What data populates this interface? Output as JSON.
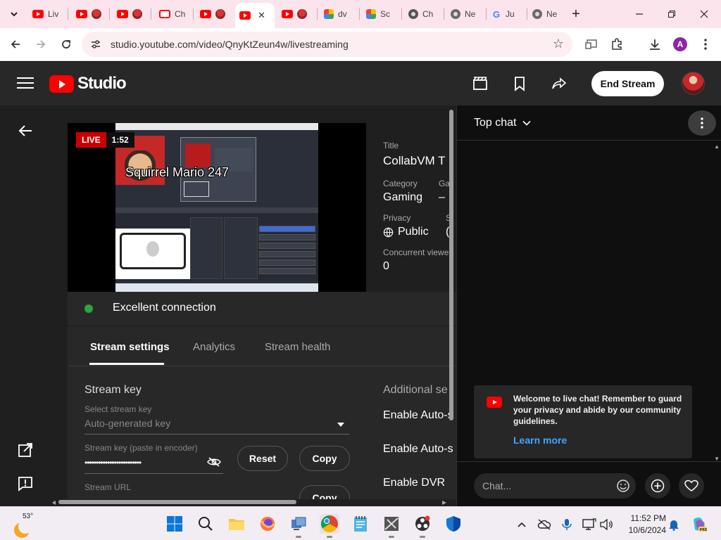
{
  "browser": {
    "tabs": [
      {
        "label": "Liv",
        "icon": "youtube-icon"
      },
      {
        "label": "",
        "icon": "mario-icon"
      },
      {
        "label": "",
        "icon": "mario-icon"
      },
      {
        "label": "Ch",
        "icon": "youtube-icon"
      },
      {
        "label": "",
        "icon": "mario-icon"
      },
      {
        "label": "",
        "icon": "youtube-icon",
        "active": true
      },
      {
        "label": "",
        "icon": "mario-icon"
      },
      {
        "label": "dv",
        "icon": "photos-icon"
      },
      {
        "label": "Sc",
        "icon": "photos-icon"
      },
      {
        "label": "Ch",
        "icon": "openai-icon"
      },
      {
        "label": "Ne",
        "icon": "chrome-icon"
      },
      {
        "label": "Ju",
        "icon": "google-icon"
      },
      {
        "label": "Ne",
        "icon": "chrome-icon"
      }
    ],
    "url": "studio.youtube.com/video/QnyKtZeun4w/livestreaming",
    "profile_initial": "A",
    "new_tab": "+",
    "close_tab": "✕"
  },
  "studio": {
    "logo_text": "Studio",
    "end_stream_label": "End Stream"
  },
  "preview": {
    "live_label": "LIVE",
    "elapsed": "1:52",
    "overlay_title": "Squirrel Mario 247"
  },
  "info": {
    "title_label": "Title",
    "title_value": "CollabVM T",
    "category_label": "Category",
    "category_value": "Gaming",
    "ga_label": "Ga",
    "ga_value": "–",
    "privacy_label": "Privacy",
    "privacy_value": "Public",
    "s_label": "S",
    "s_value": "(",
    "viewers_label": "Concurrent viewe",
    "viewers_value": "0"
  },
  "connection": {
    "status": "Excellent connection",
    "color": "#2ba640"
  },
  "tabs": {
    "stream_settings": "Stream settings",
    "analytics": "Analytics",
    "stream_health": "Stream health"
  },
  "settings": {
    "stream_key_title": "Stream key",
    "select_key_label": "Select stream key",
    "select_key_value": "Auto-generated key",
    "paste_label": "Stream key (paste in encoder)",
    "key_masked": "•••••••••••••••••••••••••",
    "reset_label": "Reset",
    "copy_label": "Copy",
    "url_label": "Stream URL",
    "copy2_label": "Copy",
    "additional_title": "Additional se",
    "opt1": "Enable Auto-s",
    "opt2": "Enable Auto-s",
    "opt3": "Enable DVR"
  },
  "chat": {
    "mode": "Top chat",
    "welcome": "Welcome to live chat! Remember to guard your privacy and abide by our community guidelines.",
    "learn_more": "Learn more",
    "placeholder": "Chat..."
  },
  "taskbar": {
    "temperature": "53°",
    "time": "11:52 PM",
    "date": "10/6/2024"
  },
  "colors": {
    "accent_red": "#ff0000",
    "link_blue": "#3ea6ff"
  }
}
